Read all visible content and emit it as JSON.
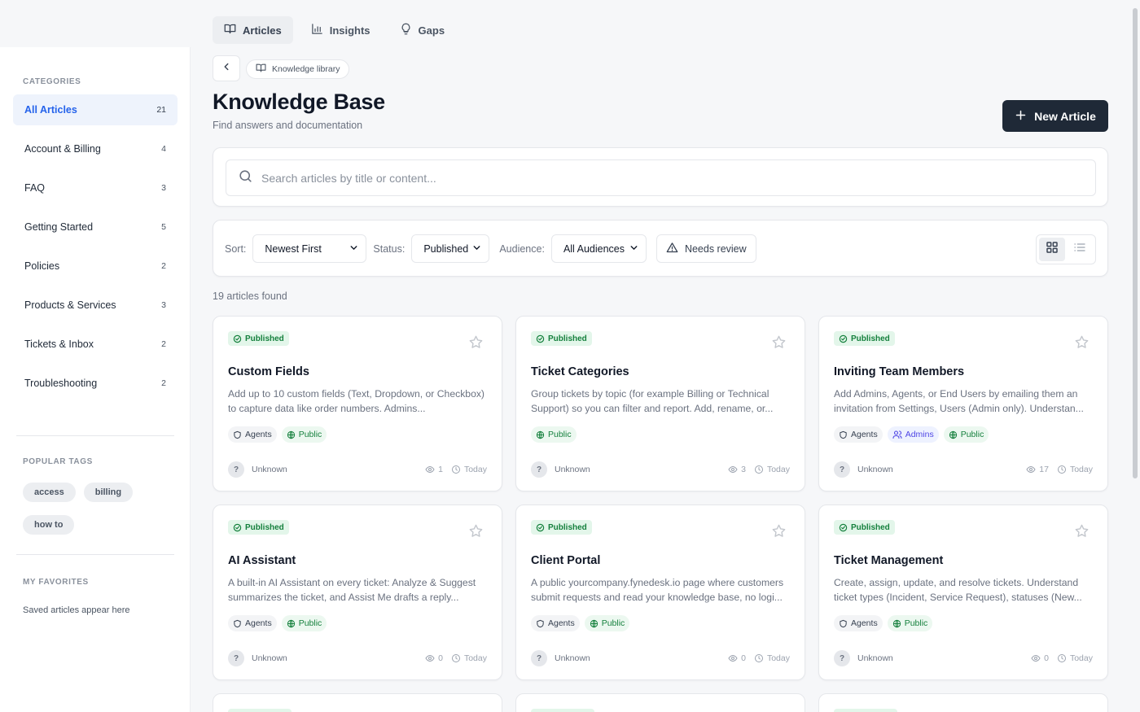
{
  "nav": {
    "tabs": [
      {
        "label": "Articles",
        "icon": "book-icon",
        "active": true
      },
      {
        "label": "Insights",
        "icon": "bar-chart-icon",
        "active": false
      },
      {
        "label": "Gaps",
        "icon": "lightbulb-icon",
        "active": false
      }
    ]
  },
  "breadcrumb": {
    "label": "Knowledge library"
  },
  "header": {
    "title": "Knowledge Base",
    "subtitle": "Find answers and documentation",
    "new_button": "New Article"
  },
  "search": {
    "placeholder": "Search articles by title or content..."
  },
  "filters": {
    "sort_label": "Sort:",
    "sort_value": "Newest First",
    "status_label": "Status:",
    "status_value": "Published",
    "audience_label": "Audience:",
    "audience_value": "All Audiences",
    "review_label": "Needs review",
    "view_mode": "grid"
  },
  "results": {
    "count_text": "19 articles found"
  },
  "sidebar": {
    "categories_heading": "CATEGORIES",
    "categories": [
      {
        "label": "All Articles",
        "count": "21",
        "active": true
      },
      {
        "label": "Account & Billing",
        "count": "4"
      },
      {
        "label": "FAQ",
        "count": "3"
      },
      {
        "label": "Getting Started",
        "count": "5"
      },
      {
        "label": "Policies",
        "count": "2"
      },
      {
        "label": "Products & Services",
        "count": "3"
      },
      {
        "label": "Tickets & Inbox",
        "count": "2"
      },
      {
        "label": "Troubleshooting",
        "count": "2"
      }
    ],
    "tags_heading": "POPULAR TAGS",
    "tags": [
      "access",
      "billing",
      "how to"
    ],
    "favorites_heading": "MY FAVORITES",
    "favorites_empty": "Saved articles appear here"
  },
  "articles": [
    {
      "status": "Published",
      "title": "Custom Fields",
      "description": "Add up to 10 custom fields (Text, Dropdown, or Checkbox) to capture data like order numbers. Admins...",
      "audiences": [
        "Agents",
        "Public"
      ],
      "author": "Unknown",
      "avatar": "?",
      "views": "1",
      "date": "Today"
    },
    {
      "status": "Published",
      "title": "Ticket Categories",
      "description": "Group tickets by topic (for example Billing or Technical Support) so you can filter and report. Add, rename, or...",
      "audiences": [
        "Public"
      ],
      "author": "Unknown",
      "avatar": "?",
      "views": "3",
      "date": "Today"
    },
    {
      "status": "Published",
      "title": "Inviting Team Members",
      "description": "Add Admins, Agents, or End Users by emailing them an invitation from Settings, Users (Admin only). Understan...",
      "audiences": [
        "Agents",
        "Admins",
        "Public"
      ],
      "author": "Unknown",
      "avatar": "?",
      "views": "17",
      "date": "Today"
    },
    {
      "status": "Published",
      "title": "AI Assistant",
      "description": "A built-in AI Assistant on every ticket: Analyze & Suggest summarizes the ticket, and Assist Me drafts a reply...",
      "audiences": [
        "Agents",
        "Public"
      ],
      "author": "Unknown",
      "avatar": "?",
      "views": "0",
      "date": "Today"
    },
    {
      "status": "Published",
      "title": "Client Portal",
      "description": "A public yourcompany.fynedesk.io page where customers submit requests and read your knowledge base, no logi...",
      "audiences": [
        "Agents",
        "Public"
      ],
      "author": "Unknown",
      "avatar": "?",
      "views": "0",
      "date": "Today"
    },
    {
      "status": "Published",
      "title": "Ticket Management",
      "description": "Create, assign, update, and resolve tickets. Understand ticket types (Incident, Service Request), statuses (New...",
      "audiences": [
        "Agents",
        "Public"
      ],
      "author": "Unknown",
      "avatar": "?",
      "views": "0",
      "date": "Today"
    }
  ],
  "colors": {
    "accent": "#2563eb",
    "primary_button": "#1f2937",
    "published": "#15803d"
  }
}
